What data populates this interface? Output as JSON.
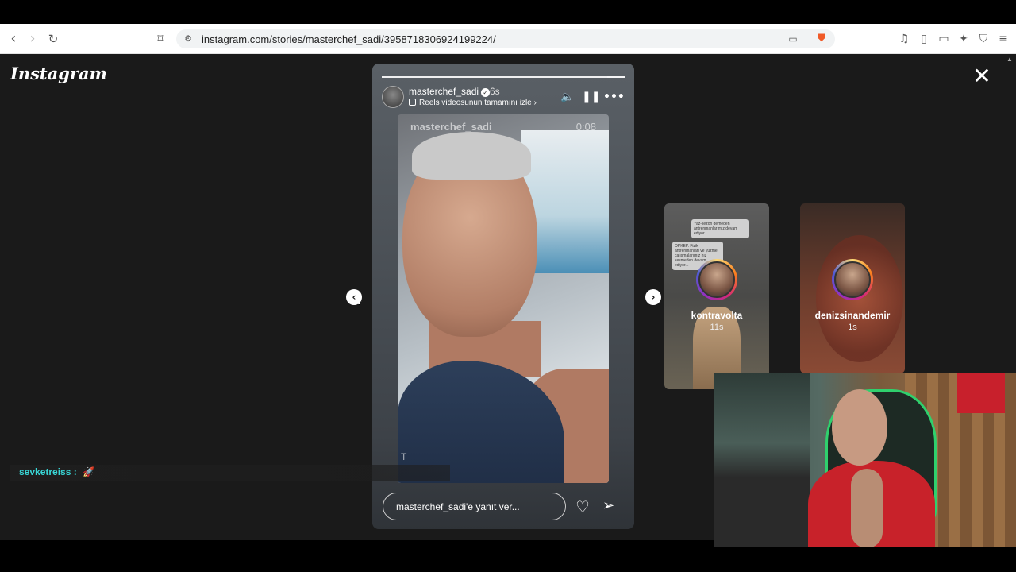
{
  "browser": {
    "url": "instagram.com/stories/masterchef_sadi/3958718306924199224/"
  },
  "page": {
    "logo": "Instagram"
  },
  "story": {
    "username": "masterchef_sadi",
    "time_ago": "6s",
    "reels_link": "Reels videosunun tamamını izle",
    "video_username": "masterchef_sadi",
    "video_time": "0:08",
    "video_mark": "T",
    "reply_placeholder": "masterchef_sadi'e yanıt ver..."
  },
  "side_stories": [
    {
      "name": "kontravolta",
      "time": "11s",
      "note1": "Yaz-sezon demeden antrenmanlarımız devam ediyor...",
      "note2": "OPKEP. Fizik antrenmanları ve yüzme çalışmalarımız hız kesmeden devam ediyor..."
    },
    {
      "name": "denizsinandemir",
      "time": "1s"
    }
  ],
  "chat": {
    "user": "sevketreiss :",
    "emote": "🚀"
  },
  "colors": {
    "page_bg": "#1a1a1a",
    "chat_user": "#39d6d6"
  }
}
